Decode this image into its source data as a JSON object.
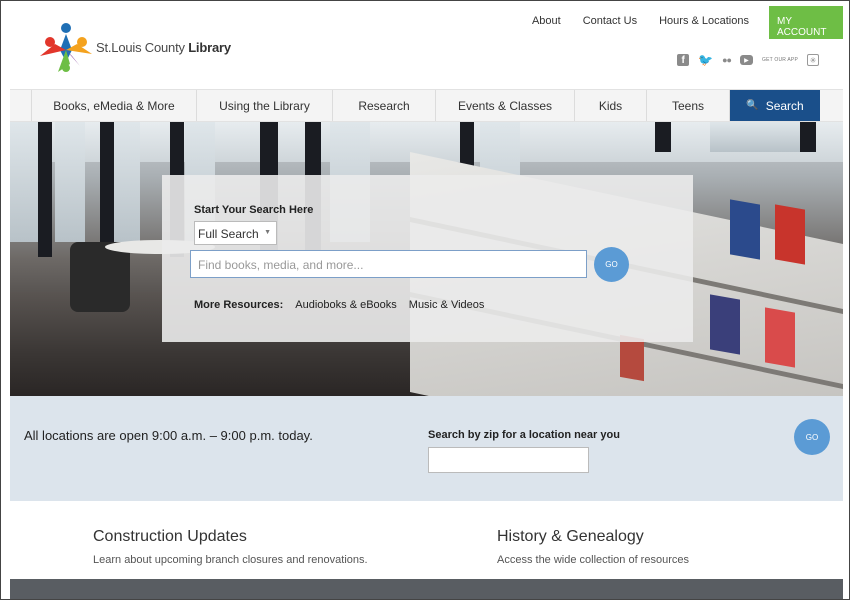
{
  "header": {
    "logo_text_light": "St.Louis County ",
    "logo_text_bold": "Library",
    "top_links": [
      "About",
      "Contact Us",
      "Hours & Locations"
    ],
    "account_label": "MY ACCOUNT",
    "social": {
      "facebook": "f",
      "twitter": "🐦",
      "flickr": "●●",
      "youtube": "▶",
      "app_label": "GET OUR APP",
      "app_icon": "✳"
    },
    "icons": [
      "logo-figures-icon",
      "facebook-icon",
      "twitter-icon",
      "flickr-icon",
      "youtube-icon",
      "app-icon"
    ]
  },
  "nav": {
    "items": [
      "Books, eMedia & More",
      "Using the Library",
      "Research",
      "Events & Classes",
      "Kids",
      "Teens"
    ],
    "search_label": "Search",
    "search_icon": "🔍"
  },
  "search_panel": {
    "title": "Start Your Search Here",
    "select_value": "Full Search",
    "input_placeholder": "Find books, media, and more...",
    "go_label": "GO",
    "resources_label": "More Resources:",
    "resources": [
      "Audioboks & eBooks",
      "Music & Videos"
    ]
  },
  "hours": {
    "text": "All locations are open 9:00 a.m. – 9:00 p.m. today.",
    "zip_label": "Search by zip for a location near you",
    "go_label": "GO"
  },
  "features": [
    {
      "title": "Construction Updates",
      "desc": "Learn about upcoming branch closures and renovations."
    },
    {
      "title": "History & Genealogy",
      "desc": "Access the wide collection of resources"
    }
  ],
  "colors": {
    "accent_green": "#6ebe45",
    "nav_blue": "#1a4f8a",
    "go_blue": "#5b9bd5",
    "band": "#dce4ec"
  }
}
